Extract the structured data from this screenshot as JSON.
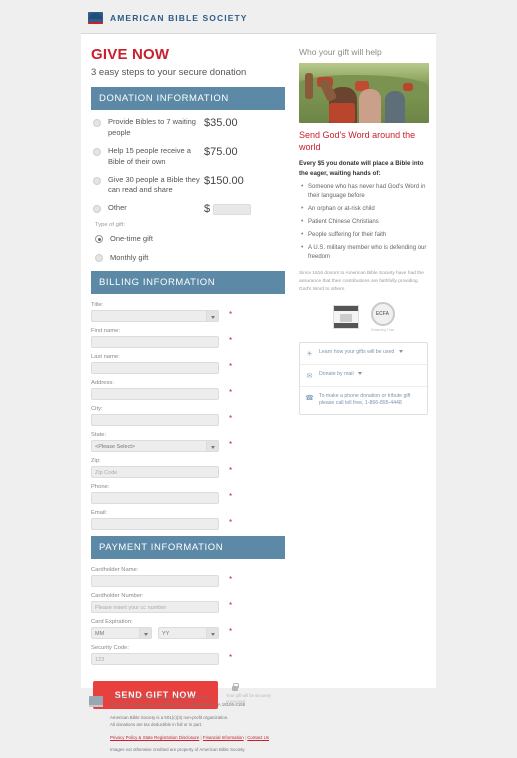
{
  "header": {
    "org_name": "AMERICAN BIBLE SOCIETY",
    "logo_icon": "abs-shield-icon"
  },
  "main": {
    "title": "GIVE NOW",
    "subtitle": "3 easy steps to your secure donation"
  },
  "donation": {
    "section_title": "DONATION INFORMATION",
    "options": [
      {
        "label": "Provide Bibles to 7 waiting people",
        "amount": "$35.00",
        "selected": false
      },
      {
        "label": "Help 15 people receive a Bible of their own",
        "amount": "$75.00",
        "selected": false
      },
      {
        "label": "Give 30 people a Bible they can read and share",
        "amount": "$150.00",
        "selected": false
      },
      {
        "label": "Other",
        "amount": "$",
        "selected": false
      }
    ],
    "other_value": "",
    "type_label": "Type of gift:",
    "gift_types": [
      {
        "label": "One-time gift",
        "selected": true
      },
      {
        "label": "Monthly gift",
        "selected": false
      }
    ]
  },
  "billing": {
    "section_title": "BILLING INFORMATION",
    "fields": [
      {
        "label": "Title:",
        "type": "select",
        "value": "",
        "placeholder": "",
        "required": "*"
      },
      {
        "label": "First name:",
        "type": "text",
        "value": "",
        "placeholder": "",
        "required": "*"
      },
      {
        "label": "Last name:",
        "type": "text",
        "value": "",
        "placeholder": "",
        "required": "*"
      },
      {
        "label": "Address:",
        "type": "text",
        "value": "",
        "placeholder": "",
        "required": "*"
      },
      {
        "label": "City:",
        "type": "text",
        "value": "",
        "placeholder": "",
        "required": "*"
      },
      {
        "label": "State:",
        "type": "select",
        "value": "<Please Select>",
        "placeholder": "",
        "required": "*"
      },
      {
        "label": "Zip:",
        "type": "text",
        "value": "",
        "placeholder": "Zip Code",
        "required": "*"
      },
      {
        "label": "Phone:",
        "type": "text",
        "value": "",
        "placeholder": "",
        "required": "*"
      },
      {
        "label": "Email:",
        "type": "text",
        "value": "",
        "placeholder": "",
        "required": "*"
      }
    ]
  },
  "payment": {
    "section_title": "PAYMENT INFORMATION",
    "cardholder_name_label": "Cardholder Name:",
    "cardholder_name_value": "",
    "cardholder_number_label": "Cardholder Number:",
    "cardholder_number_placeholder": "Please insert your cc number",
    "expiration_label": "Card Expiration:",
    "expiration_month": "MM",
    "expiration_year": "YY",
    "security_code_label": "Security Code:",
    "security_code_placeholder": "123",
    "required_marker": "*"
  },
  "submit": {
    "button_label": "SEND GIFT NOW",
    "secure_text": "Your gift will be securely processed",
    "lock_icon": "lock-icon",
    "button_color": "#e8403f"
  },
  "sidebar": {
    "title": "Who your gift will help",
    "image_alt": "people-holding-bibles-photo",
    "heading": "Send God's Word around the world",
    "intro": "Every $5 you donate will place a Bible into the eager, waiting hands of:",
    "bullets": [
      "Someone who has never had God's Word in their language before",
      "An orphan or at-risk child",
      "Patient Chinese Christians",
      "People suffering for their faith",
      "A U.S. military member who is defending our freedom"
    ],
    "note": "Since 1816 donors to American Bible Society have had the assurance that their contributions are faithfully providing God's Word to others.",
    "badges": [
      {
        "name": "charity-navigator-badge",
        "caption": ""
      },
      {
        "name": "ecfa-badge",
        "label": "ECFA",
        "caption": "Enhancing Trust"
      }
    ],
    "contact_options": [
      {
        "icon": "globe-icon",
        "text": "Learn how your gifts will be used",
        "has_caret": true
      },
      {
        "icon": "mail-icon",
        "text": "Donate by mail",
        "has_caret": true
      },
      {
        "icon": "phone-icon",
        "text": "To make a phone donation or tribute gift please call toll free, 1-866-895-4448",
        "has_caret": false
      }
    ]
  },
  "footer": {
    "logo_icon": "abs-footer-logo-icon",
    "copyright": "© 2018 American Bible Society. All Rights Reserved.",
    "address": "101 North Independence Mall East FL8, Philadelphia, PA 19106-2155",
    "nonprofit": "American Bible Society is a 501(c)(3) non-profit organization.",
    "tax": "All donations are tax deductible in full or in part.",
    "links": [
      "Privacy Policy & State Registration Disclosure",
      "Financial Information",
      "Contact Us"
    ],
    "link_separator": " | ",
    "credit": "Images not otherwise credited are property of American Bible Society."
  }
}
